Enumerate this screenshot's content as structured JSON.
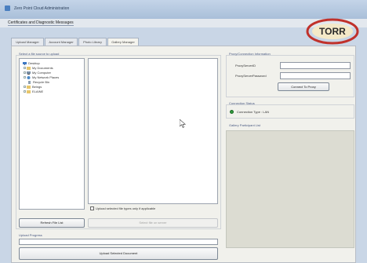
{
  "window": {
    "title": "Zero Point Cloud Administration"
  },
  "menu": {
    "item": "Certificates and Diagnostic Messages"
  },
  "logo": {
    "text": "TORR",
    "color": "#c0312b"
  },
  "tabs": [
    {
      "label": "Upload Manager"
    },
    {
      "label": "Account Manager"
    },
    {
      "label": "Photo Library"
    },
    {
      "label": "Gallery Manager"
    }
  ],
  "left_panel": {
    "title": "Select a file source to upload",
    "tree": [
      {
        "label": "Desktop",
        "icon": "desktop-icon"
      },
      {
        "label": "My Documents",
        "icon": "folder-icon"
      },
      {
        "label": "My Computer",
        "icon": "computer-icon"
      },
      {
        "label": "My Network Places",
        "icon": "network-icon"
      },
      {
        "label": "Recycle Bin",
        "icon": "recycle-bin-icon"
      },
      {
        "label": "Beings",
        "icon": "folder-icon"
      },
      {
        "label": "ELAINE",
        "icon": "folder-icon"
      }
    ],
    "checkbox_label": "Upload selected file types only if applicable",
    "refresh_button": "Refresh File List",
    "select_all_button": "Select file on server",
    "progress_title": "Upload Progress",
    "upload_button": "Upload Selected Document"
  },
  "right_panel": {
    "conn_title": "Proxy/Connection Information",
    "user_label": "ProxyServerID",
    "password_label": "ProxyServerPassword",
    "connect_button": "Connect To Proxy",
    "status_title": "Connection Status",
    "status_text": "Connection Type : LAN",
    "status_color": "#2f9a3c",
    "gallery_title": "Gallery Participant List"
  }
}
